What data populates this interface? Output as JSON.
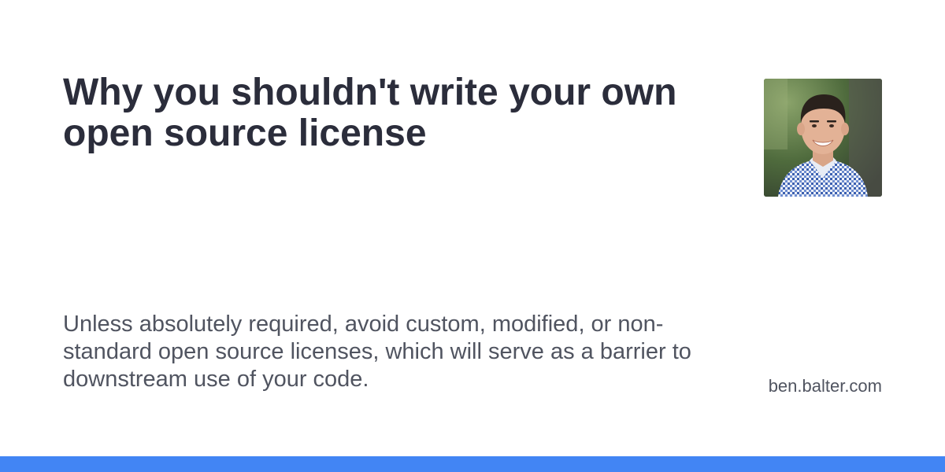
{
  "title": "Why you shouldn't write your own open source license",
  "description": "Unless absolutely required, avoid custom, modified, or non-standard open source licenses, which will serve as a barrier to downstream use of your code.",
  "site": "ben.balter.com",
  "avatar_icon": "person-photo",
  "colors": {
    "background": "#ffffff",
    "title": "#2b2d3b",
    "body_text": "#505460",
    "accent_bar": "#4285f4"
  }
}
